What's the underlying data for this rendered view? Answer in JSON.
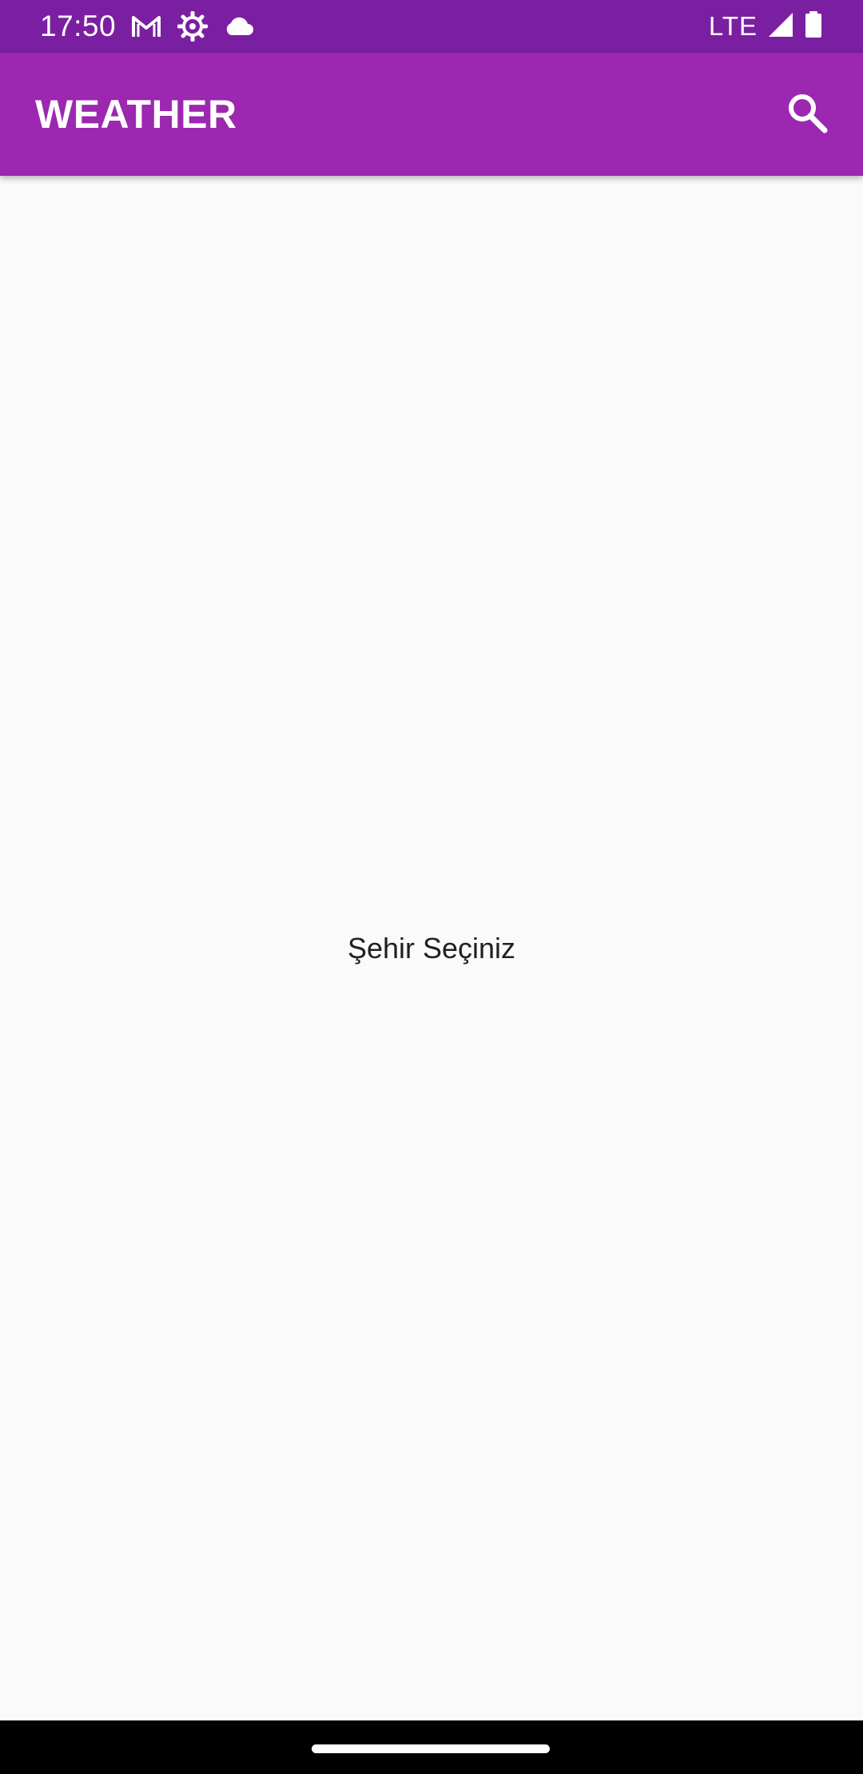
{
  "status_bar": {
    "time": "17:50",
    "network": "LTE",
    "icons": [
      "gmail-icon",
      "settings-gear-icon",
      "cloud-icon",
      "signal-icon",
      "battery-icon"
    ]
  },
  "app_bar": {
    "title": "WEATHER",
    "action_icon": "search-icon"
  },
  "content": {
    "message": "Şehir Seçiniz"
  },
  "colors": {
    "status_bar": "#7b1fa2",
    "app_bar": "#9c27b0",
    "background": "#fafafa",
    "text": "#212121"
  }
}
